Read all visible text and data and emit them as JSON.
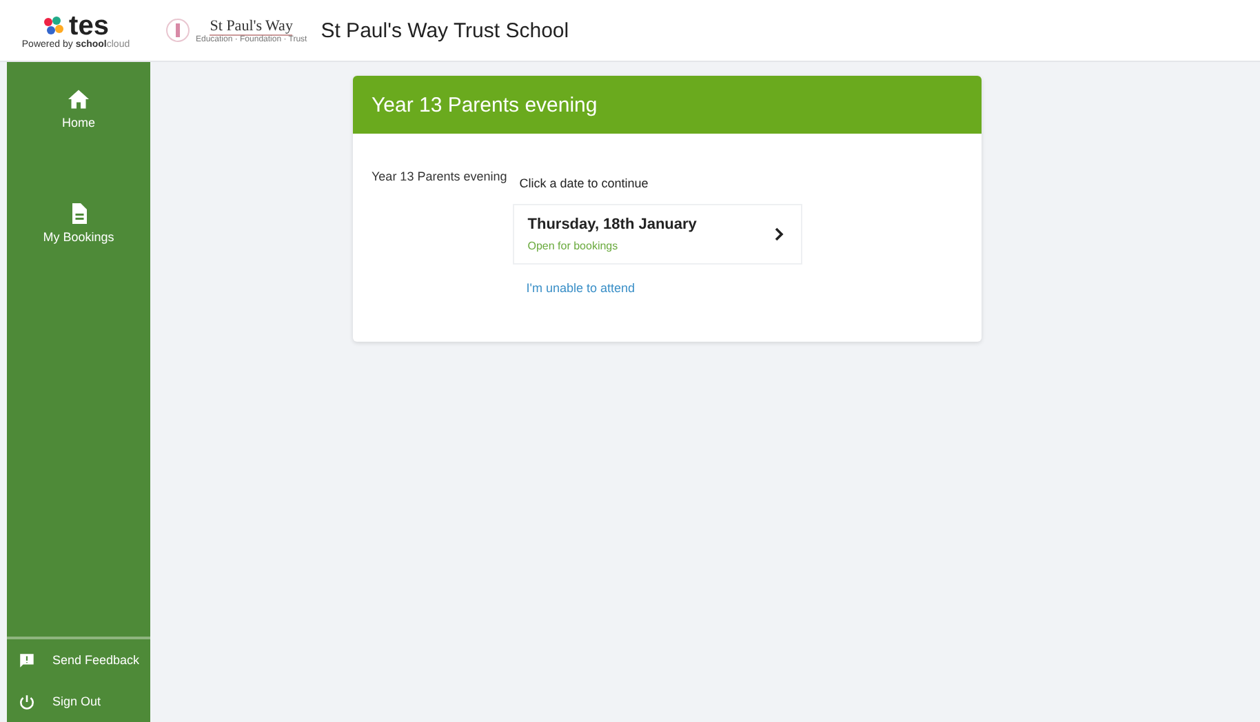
{
  "header": {
    "brand": {
      "name": "tes",
      "tagline_prefix": "Powered by",
      "tagline_bold": "school",
      "tagline_light": "cloud"
    },
    "school_logo": {
      "name": "St Paul's Way",
      "motto": "Education · Foundation · Trust"
    },
    "school_name": "St Paul's Way Trust School"
  },
  "sidebar": {
    "items": [
      {
        "label": "Home"
      },
      {
        "label": "My Bookings"
      }
    ],
    "footer_items": [
      {
        "label": "Send Feedback"
      },
      {
        "label": "Sign Out"
      }
    ]
  },
  "event_card": {
    "title": "Year 13 Parents evening",
    "description": "Year 13 Parents evening",
    "prompt": "Click a date to continue",
    "dates": [
      {
        "date": "Thursday, 18th January",
        "status": "Open for bookings"
      }
    ],
    "unable_link": "I'm unable to attend"
  }
}
